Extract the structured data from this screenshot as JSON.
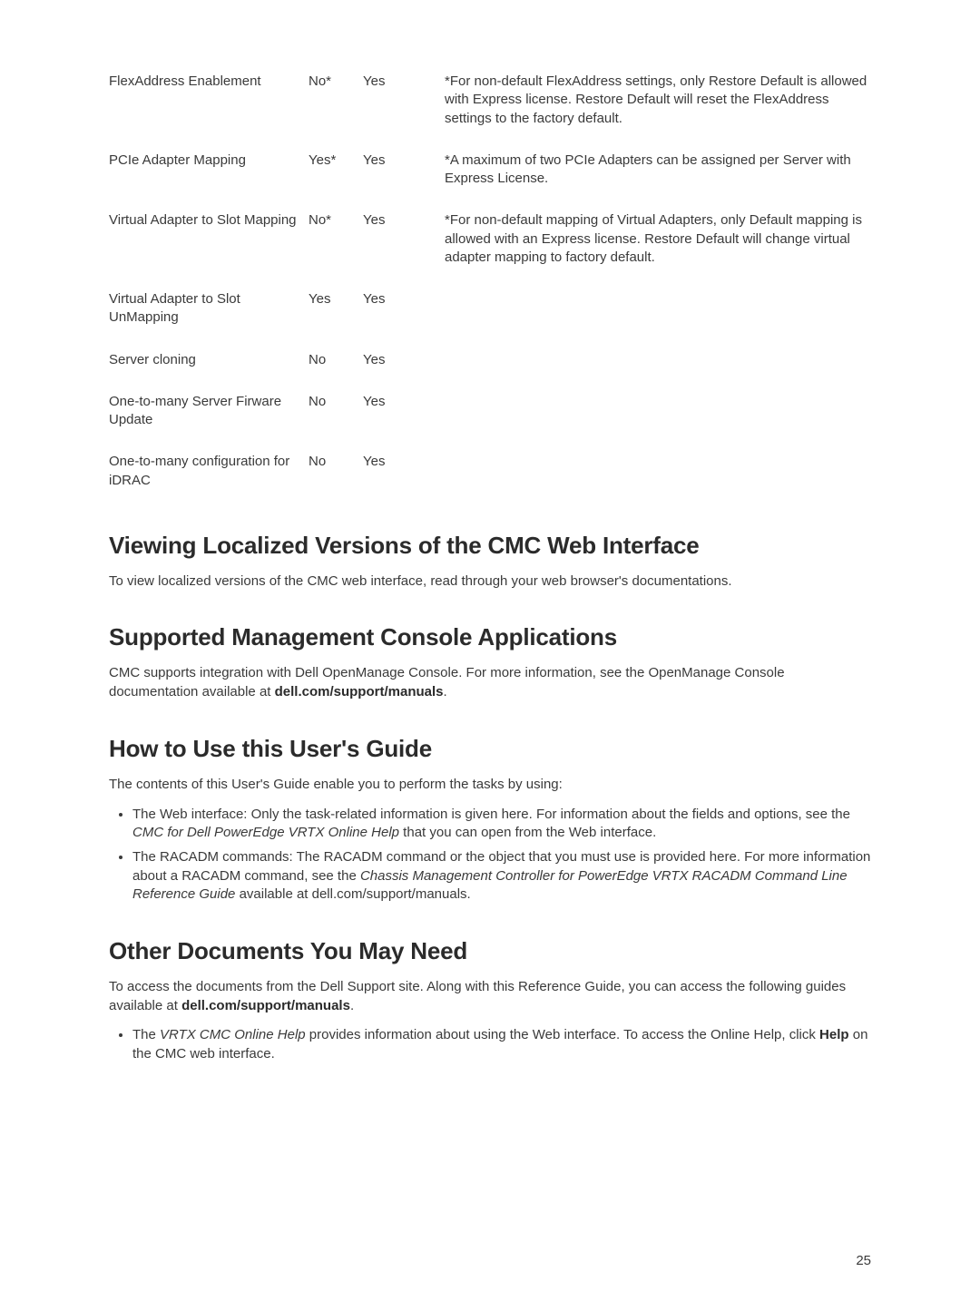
{
  "table": {
    "rows": [
      {
        "feature": "FlexAddress Enablement",
        "express": "No*",
        "enterprise": "Yes",
        "note": "*For non-default FlexAddress settings, only Restore Default is allowed with Express license. Restore Default will reset the FlexAddress settings to the factory default."
      },
      {
        "feature": "PCIe Adapter Mapping",
        "express": "Yes*",
        "enterprise": "Yes",
        "note": "*A maximum of two PCIe Adapters can be assigned per Server with Express License."
      },
      {
        "feature": "Virtual Adapter to Slot Mapping",
        "express": "No*",
        "enterprise": "Yes",
        "note": "*For non-default mapping of Virtual Adapters, only Default mapping is allowed with an Express license. Restore Default will change virtual adapter mapping to factory default."
      },
      {
        "feature": "Virtual Adapter to Slot UnMapping",
        "express": "Yes",
        "enterprise": "Yes",
        "note": ""
      },
      {
        "feature": "Server cloning",
        "express": "No",
        "enterprise": "Yes",
        "note": ""
      },
      {
        "feature": "One-to-many Server Firware Update",
        "express": "No",
        "enterprise": "Yes",
        "note": ""
      },
      {
        "feature": "One-to-many configuration for iDRAC",
        "express": "No",
        "enterprise": "Yes",
        "note": ""
      }
    ]
  },
  "sections": {
    "localized": {
      "title": "Viewing Localized Versions of the CMC Web Interface",
      "body": "To view localized versions of the CMC web interface, read through your web browser's documentations."
    },
    "management": {
      "title": "Supported Management Console Applications",
      "body_prefix": "CMC supports integration with Dell OpenManage Console. For more information, see the OpenManage Console documentation available at ",
      "body_bold": "dell.com/support/manuals",
      "body_suffix": "."
    },
    "howto": {
      "title": "How to Use this User's Guide",
      "intro": "The contents of this User's Guide enable you to perform the tasks by using:",
      "bullet1_pre": "The Web interface: Only the task-related information is given here. For information about the fields and options, see the ",
      "bullet1_italic": "CMC for Dell PowerEdge VRTX Online Help",
      "bullet1_post": " that you can open from the Web interface.",
      "bullet2_pre": "The RACADM commands: The RACADM command or the object that you must use is provided here. For more information about a RACADM command, see the ",
      "bullet2_italic": "Chassis Management Controller for PowerEdge VRTX RACADM Command Line Reference Guide",
      "bullet2_post": " available at dell.com/support/manuals."
    },
    "other": {
      "title": "Other Documents You May Need",
      "body_pre": "To access the documents from the Dell Support site. Along with this Reference Guide, you can access the following guides available at ",
      "body_bold": "dell.com/support/manuals",
      "body_post": ".",
      "bullet_pre": "The ",
      "bullet_italic": "VRTX CMC Online Help",
      "bullet_mid": " provides information about using the Web interface. To access the Online Help, click ",
      "bullet_bold": "Help",
      "bullet_post": " on the CMC web interface."
    }
  },
  "page_number": "25"
}
